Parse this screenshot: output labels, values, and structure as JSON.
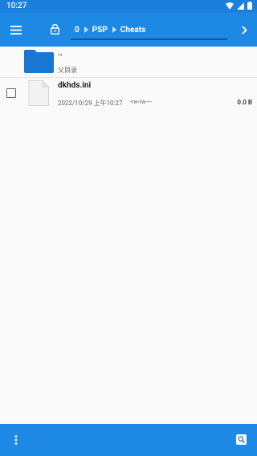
{
  "status_bar": {
    "time": "10:27"
  },
  "toolbar": {
    "breadcrumbs": [
      "0",
      "PSP",
      "Cheats"
    ]
  },
  "list": {
    "parent": {
      "name": "..",
      "label": "父目录"
    },
    "files": [
      {
        "name": "dkhds.ini",
        "modified": "2022/10/29 上午10:27",
        "permissions": "-rw-rw----",
        "size": "0.0 B"
      }
    ]
  },
  "colors": {
    "accent": "#1e88e5",
    "status_bar": "#1a80dc",
    "folder": "#1976d2"
  }
}
